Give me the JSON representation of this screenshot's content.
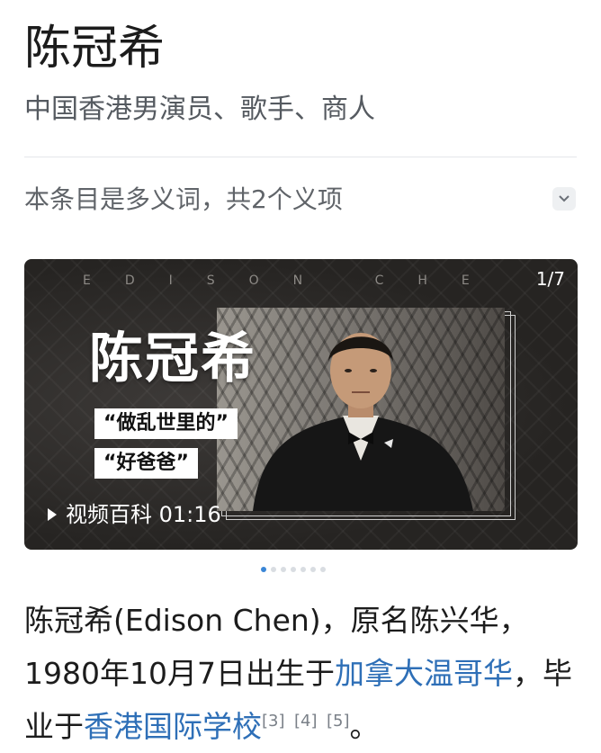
{
  "header": {
    "title": "陈冠希",
    "subtitle": "中国香港男演员、歌手、商人",
    "disambiguation": "本条目是多义词，共2个义项",
    "toggle_icon": "chevron-down-icon"
  },
  "media": {
    "watermark": "EDISON CHE",
    "counter": "1/7",
    "overlay_name": "陈冠希",
    "tag_line_1": "“做乱世里的”",
    "tag_line_2": "“好爸爸”",
    "video_label": "视频百科 01:16",
    "carousel_total": 7,
    "carousel_active": 1,
    "active_dot_color": "#3a86d6"
  },
  "article": {
    "seg1": "陈冠希(Edison Chen)，原名陈兴华，1980年10月7日出生于",
    "link1": "加拿大温哥华",
    "seg2": "，毕业于",
    "link2": "香港国际学校",
    "ref1": "[3]",
    "ref2": "[4]",
    "ref3": "[5]",
    "seg3": "。",
    "link_color": "#2e6fb7"
  }
}
